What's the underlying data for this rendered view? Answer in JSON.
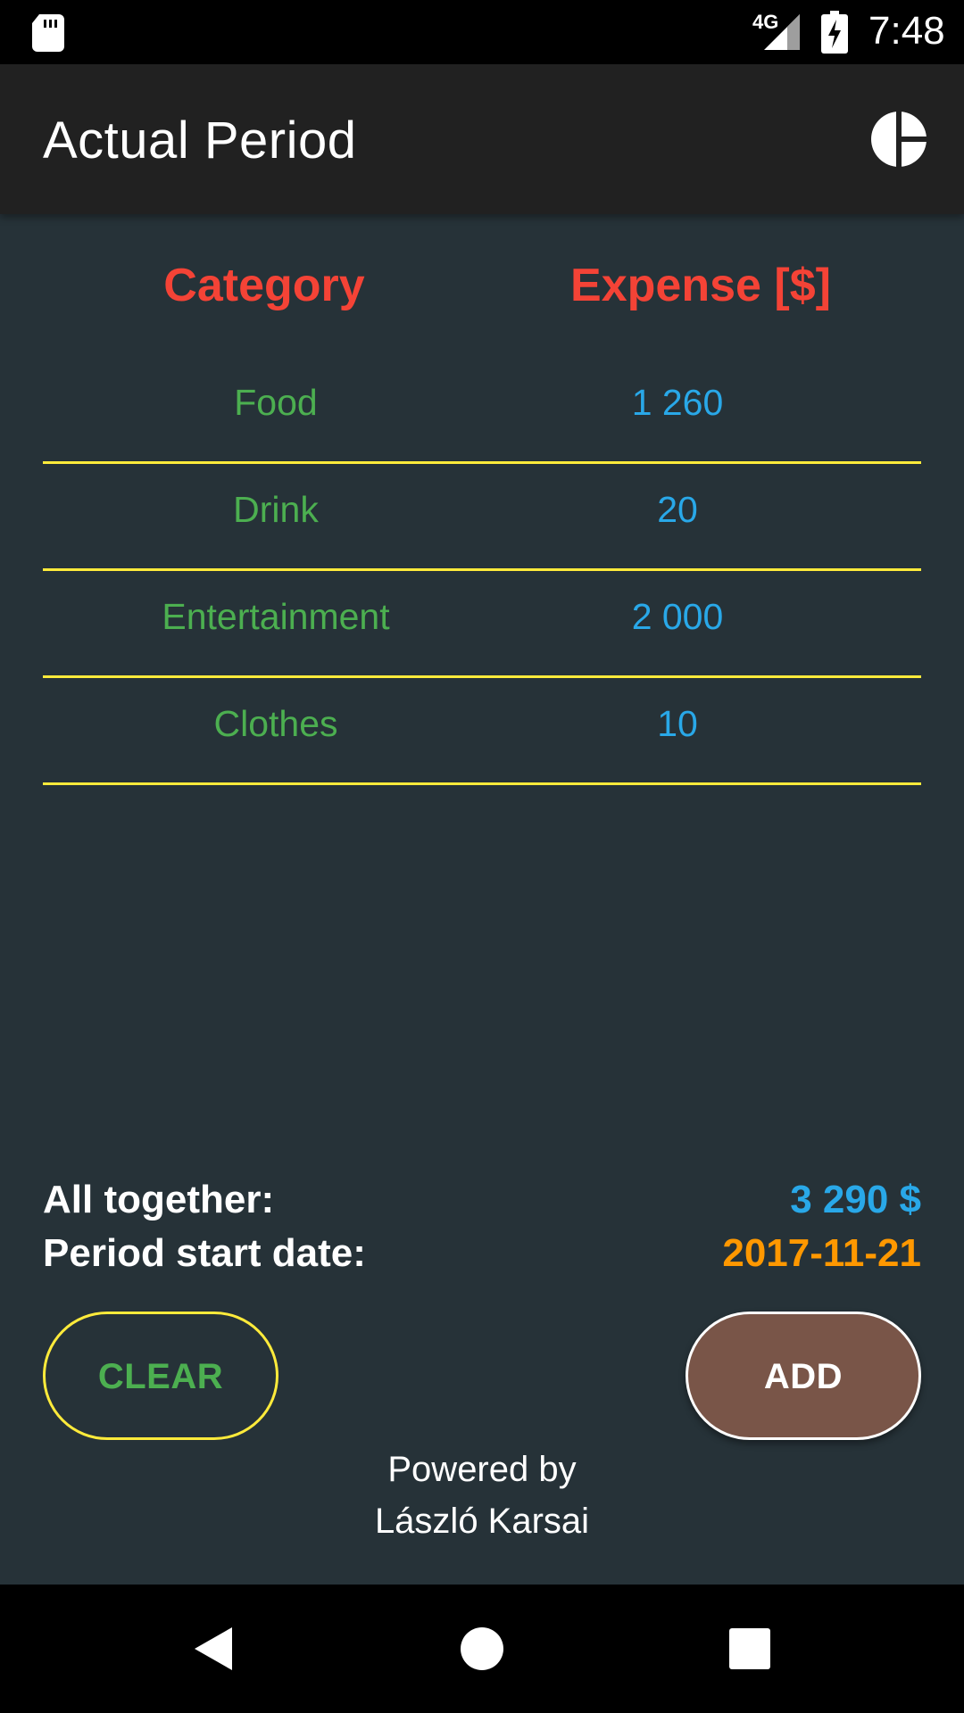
{
  "status_bar": {
    "network_label": "4G",
    "time": "7:48"
  },
  "app_bar": {
    "title": "Actual Period",
    "action_icon": "pie-chart-icon"
  },
  "table": {
    "headers": {
      "category": "Category",
      "expense": "Expense [$]"
    },
    "rows": [
      {
        "category": "Food",
        "amount": "1 260"
      },
      {
        "category": "Drink",
        "amount": "20"
      },
      {
        "category": "Entertainment",
        "amount": "2 000"
      },
      {
        "category": "Clothes",
        "amount": "10"
      }
    ]
  },
  "summary": {
    "total_label": "All together:",
    "total_value": "3 290 $",
    "start_label": "Period start date:",
    "start_value": "2017-11-21"
  },
  "buttons": {
    "clear": "CLEAR",
    "add": "ADD"
  },
  "footer": {
    "line1": "Powered by",
    "line2": "László Karsai"
  },
  "colors": {
    "background": "#263238",
    "app_bar": "#212121",
    "header_text": "#f44336",
    "category_text": "#4caf50",
    "amount_text": "#29a8e8",
    "divider": "#ffeb3b",
    "date_text": "#ff9800",
    "add_button": "#795548"
  }
}
